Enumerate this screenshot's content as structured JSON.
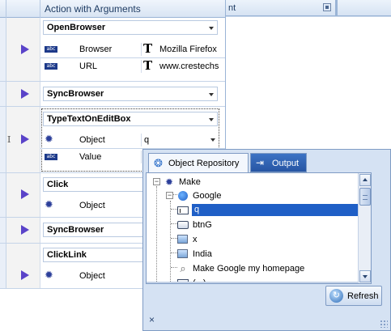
{
  "grid": {
    "column_header": "Action with Arguments",
    "steps": [
      {
        "action": "OpenBrowser",
        "args": [
          {
            "kind": "abc",
            "name": "Browser",
            "value": "Mozilla Firefox",
            "typed": true
          },
          {
            "kind": "abc",
            "name": "URL",
            "value": "www.crestechs",
            "typed": true
          }
        ]
      },
      {
        "action": "SyncBrowser",
        "args": []
      },
      {
        "action": "TypeTextOnEditBox",
        "args": [
          {
            "kind": "object",
            "name": "Object",
            "value": "q",
            "typed": false
          },
          {
            "kind": "abc",
            "name": "Value",
            "value": "",
            "typed": false
          }
        ]
      },
      {
        "action": "Click",
        "args": [
          {
            "kind": "object",
            "name": "Object",
            "value": "",
            "typed": false
          }
        ]
      },
      {
        "action": "SyncBrowser",
        "args": []
      },
      {
        "action": "ClickLink",
        "args": [
          {
            "kind": "object",
            "name": "Object",
            "value": "",
            "typed": false
          }
        ]
      }
    ]
  },
  "right_pane": {
    "header_label": "nt"
  },
  "dialog": {
    "tabs": [
      {
        "label": "Object Repository",
        "active": true,
        "icon": "repository-icon"
      },
      {
        "label": "Output",
        "active": false,
        "icon": "output-icon"
      }
    ],
    "tree": [
      {
        "label": "Make",
        "icon": "gear-icon",
        "level": 0
      },
      {
        "label": "Google",
        "icon": "globe-icon",
        "level": 1
      },
      {
        "label": "q",
        "icon": "textbox-icon",
        "level": 2,
        "selected": true
      },
      {
        "label": "btnG",
        "icon": "button-icon",
        "level": 2
      },
      {
        "label": "x",
        "icon": "image-icon",
        "level": 2
      },
      {
        "label": "India",
        "icon": "image-icon",
        "level": 2
      },
      {
        "label": "Make Google my homepage",
        "icon": "link-icon",
        "level": 2
      },
      {
        "label": "(...)",
        "icon": "textbox-icon",
        "level": 2
      }
    ],
    "refresh_label": "Refresh",
    "close_glyph": "×"
  },
  "colors": {
    "accent": "#1f5fc6",
    "play": "#5a43c9",
    "tab_active": "#2755a3"
  }
}
